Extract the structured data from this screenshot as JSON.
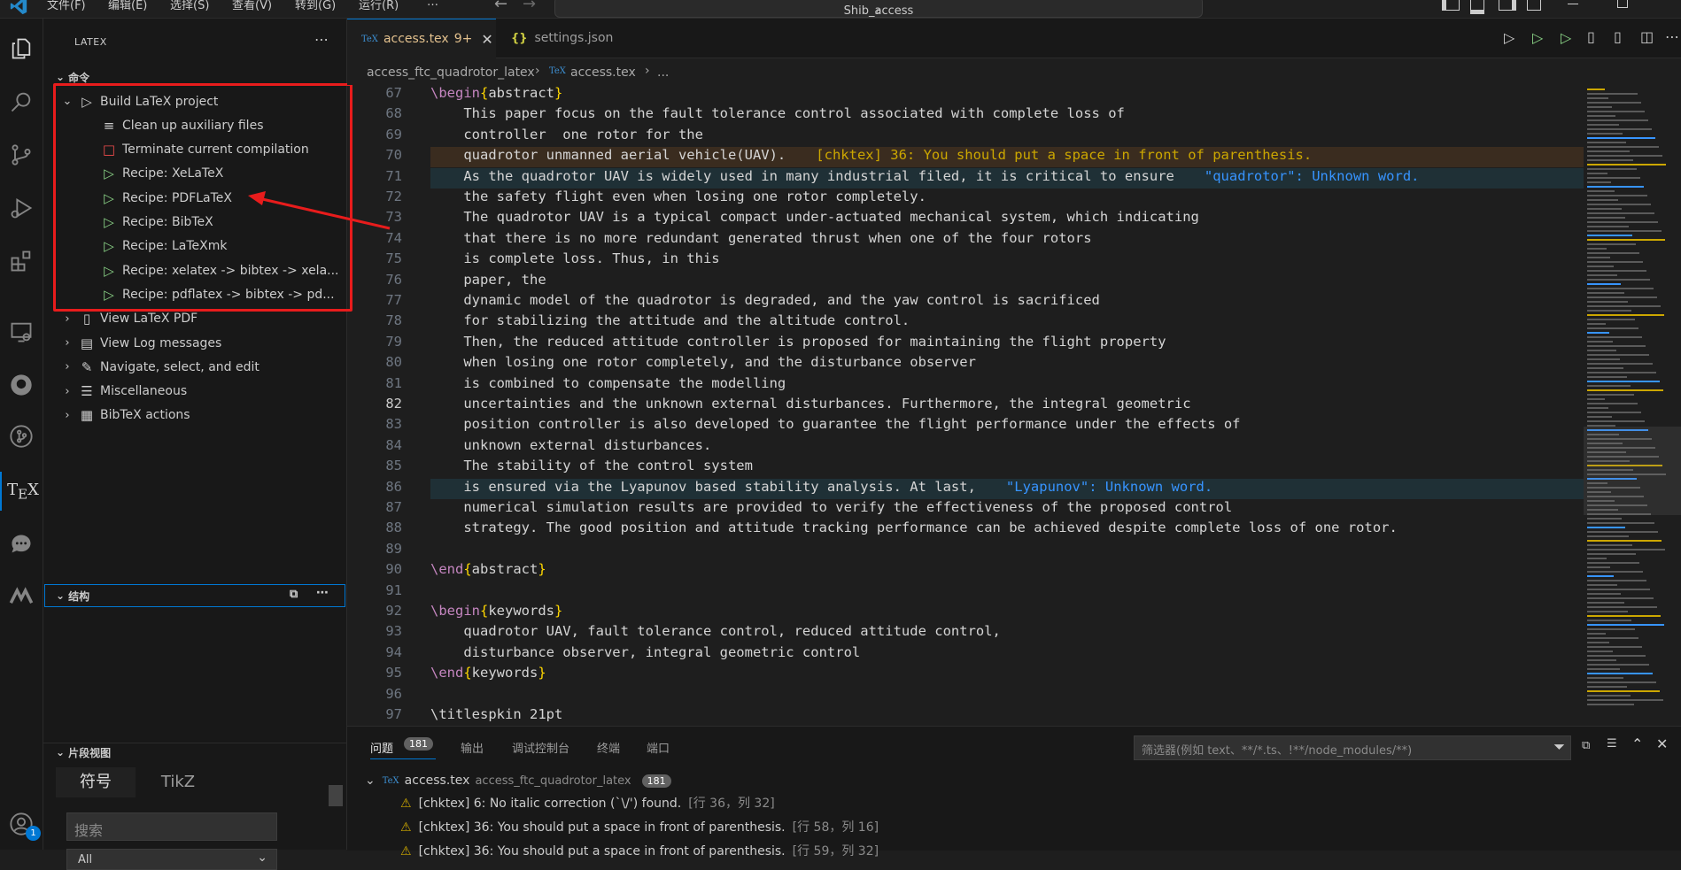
{
  "menu": {
    "items": [
      "文件(F)",
      "编辑(E)",
      "选择(S)",
      "查看(V)",
      "转到(G)",
      "运行(R)",
      "…"
    ],
    "search_text": "Shib_access"
  },
  "sidebar": {
    "title": "LATEX",
    "commands_label": "命令",
    "tree": [
      {
        "label": "Build LaTeX project",
        "icon": "play-outline-icon",
        "indent": 1,
        "expanded": true
      },
      {
        "label": "Clean up auxiliary files",
        "icon": "clear-all-icon",
        "indent": 2
      },
      {
        "label": "Terminate current compilation",
        "icon": "stop-square-icon",
        "indent": 2
      },
      {
        "label": "Recipe: XeLaTeX",
        "icon": "run-icon",
        "indent": 2
      },
      {
        "label": "Recipe: PDFLaTeX",
        "icon": "run-icon",
        "indent": 2
      },
      {
        "label": "Recipe: BibTeX",
        "icon": "run-icon",
        "indent": 2
      },
      {
        "label": "Recipe: LaTeXmk",
        "icon": "run-icon",
        "indent": 2
      },
      {
        "label": "Recipe: xelatex -> bibtex -> xela...",
        "icon": "run-icon",
        "indent": 2
      },
      {
        "label": "Recipe: pdflatex -> bibtex -> pd...",
        "icon": "run-icon",
        "indent": 2
      },
      {
        "label": "View LaTeX PDF",
        "icon": "pdf-preview-icon",
        "indent": 1
      },
      {
        "label": "View Log messages",
        "icon": "log-file-icon",
        "indent": 1
      },
      {
        "label": "Navigate, select, and edit",
        "icon": "pencil-icon",
        "indent": 1
      },
      {
        "label": "Miscellaneous",
        "icon": "menu-lines-icon",
        "indent": 1
      },
      {
        "label": "BibTeX actions",
        "icon": "bibtex-icon",
        "indent": 1
      }
    ],
    "structure_label": "结构",
    "snippet_label": "片段视图",
    "snippet_tabs": [
      "符号",
      "TikZ"
    ],
    "search_placeholder": "搜索",
    "filter_value": "All"
  },
  "tabs": [
    {
      "label": "access.tex",
      "badge": "9+",
      "active": true
    },
    {
      "label": "settings.json",
      "active": false
    }
  ],
  "breadcrumb": [
    "access_ftc_quadrotor_latex",
    "access.tex",
    "..."
  ],
  "code_lines": [
    {
      "n": "67",
      "t": "\\begin{abstract}"
    },
    {
      "n": "68",
      "t": "    This paper focus on the fault tolerance control associated with complete loss of"
    },
    {
      "n": "69",
      "t": "    controller  one rotor for the"
    },
    {
      "n": "70",
      "t": "    quadrotor unmanned aerial vehicle(UAV).",
      "diag": "[chktex] 36: You should put a space in front of parenthesis.",
      "kind": "warn"
    },
    {
      "n": "71",
      "t": "    As the quadrotor UAV is widely used in many industrial filed, it is critical to ensure",
      "diag": "\"quadrotor\": Unknown word.",
      "kind": "info"
    },
    {
      "n": "72",
      "t": "    the safety flight even when losing one rotor completely."
    },
    {
      "n": "73",
      "t": "    The quadrotor UAV is a typical compact under-actuated mechanical system, which indicating"
    },
    {
      "n": "74",
      "t": "    that there is no more redundant generated thrust when one of the four rotors"
    },
    {
      "n": "75",
      "t": "    is complete loss. Thus, in this"
    },
    {
      "n": "76",
      "t": "    paper, the"
    },
    {
      "n": "77",
      "t": "    dynamic model of the quadrotor is degraded, and the yaw control is sacrificed"
    },
    {
      "n": "78",
      "t": "    for stabilizing the attitude and the altitude control."
    },
    {
      "n": "79",
      "t": "    Then, the reduced attitude controller is proposed for maintaining the flight property"
    },
    {
      "n": "80",
      "t": "    when losing one rotor completely, and the disturbance observer"
    },
    {
      "n": "81",
      "t": "    is combined to compensate the modelling"
    },
    {
      "n": "82",
      "t": "    uncertainties and the unknown external disturbances. Furthermore, the integral geometric",
      "current": true
    },
    {
      "n": "83",
      "t": "    position controller is also developed to guarantee the flight performance under the effects of"
    },
    {
      "n": "84",
      "t": "    unknown external disturbances."
    },
    {
      "n": "85",
      "t": "    The stability of the control system"
    },
    {
      "n": "86",
      "t": "    is ensured via the Lyapunov based stability analysis. At last,",
      "diag": "\"Lyapunov\": Unknown word.",
      "kind": "info"
    },
    {
      "n": "87",
      "t": "    numerical simulation results are provided to verify the effectiveness of the proposed control"
    },
    {
      "n": "88",
      "t": "    strategy. The good position and attitude tracking performance can be achieved despite complete loss of one rotor."
    },
    {
      "n": "89",
      "t": ""
    },
    {
      "n": "90",
      "t": "\\end{abstract}"
    },
    {
      "n": "91",
      "t": ""
    },
    {
      "n": "92",
      "t": "\\begin{keywords}"
    },
    {
      "n": "93",
      "t": "    quadrotor UAV, fault tolerance control, reduced attitude control,"
    },
    {
      "n": "94",
      "t": "    disturbance observer, integral geometric control"
    },
    {
      "n": "95",
      "t": "\\end{keywords}"
    },
    {
      "n": "96",
      "t": ""
    },
    {
      "n": "97",
      "t": "\\titlespkin 21pt"
    }
  ],
  "panel": {
    "tabs": [
      "问题",
      "输出",
      "调试控制台",
      "终端",
      "端口"
    ],
    "problem_count": "181",
    "filter_placeholder": "筛选器(例如 text、**/*.ts、!**/node_modules/**)",
    "file": {
      "name": "access.tex",
      "folder": "access_ftc_quadrotor_latex",
      "count": "181"
    },
    "problems": [
      {
        "msg": "[chktex] 6: No italic correction (`\\/') found.",
        "loc": "[行 36，列 32]"
      },
      {
        "msg": "[chktex] 36: You should put a space in front of parenthesis.",
        "loc": "[行 58，列 16]"
      },
      {
        "msg": "[chktex] 36: You should put a space in front of parenthesis.",
        "loc": "[行 59，列 32]"
      }
    ]
  },
  "accounts_badge": "1",
  "colors": {
    "accent": "#0078d4",
    "warning": "#cca700",
    "highlight_red": "#e81c1c",
    "run_green": "#89d185"
  }
}
